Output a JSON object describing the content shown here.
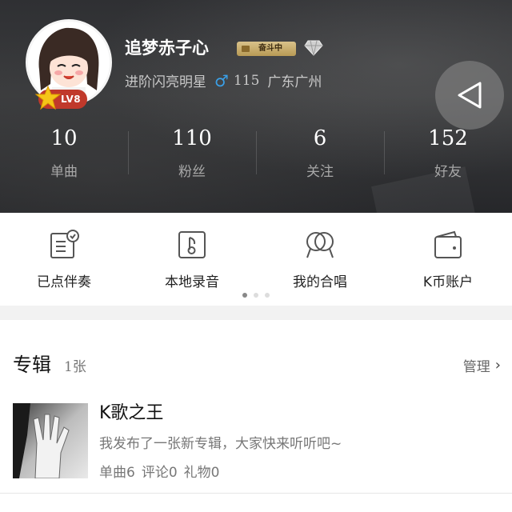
{
  "profile": {
    "username": "追梦赤子心",
    "level_badge": "LV8",
    "rank_badge": "奋斗中",
    "title": "进阶闪亮明星",
    "gender_icon": "male-icon",
    "age": "115",
    "location": "广东广州"
  },
  "stats": [
    {
      "value": "10",
      "label": "单曲"
    },
    {
      "value": "110",
      "label": "粉丝"
    },
    {
      "value": "6",
      "label": "关注"
    },
    {
      "value": "152",
      "label": "好友"
    }
  ],
  "quick_menu": [
    {
      "label": "已点伴奏",
      "icon": "accompaniment-icon"
    },
    {
      "label": "本地录音",
      "icon": "local-recording-icon"
    },
    {
      "label": "我的合唱",
      "icon": "chorus-icon"
    },
    {
      "label": "K币账户",
      "icon": "wallet-icon"
    }
  ],
  "pager": {
    "count": 3,
    "active": 0
  },
  "album_section": {
    "title": "专辑",
    "count": "1张",
    "manage_label": "管理",
    "albums": [
      {
        "name": "K歌之王",
        "description": "我发布了一张新专辑，大家快来听听吧~",
        "singles": "单曲6",
        "comments": "评论0",
        "gifts": "礼物0"
      }
    ]
  },
  "colors": {
    "header_bg": "#2f3033",
    "level_badge": "#c0392b",
    "gender_blue": "#3aa0e8",
    "rank_gold": "#c8ad6b"
  }
}
